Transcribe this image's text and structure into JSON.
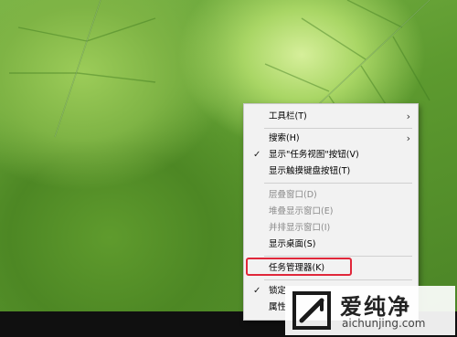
{
  "desktop": {
    "context_menu": {
      "items": [
        {
          "label": "工具栏(T)",
          "checked": false,
          "disabled": false,
          "submenu": true
        },
        {
          "label": "搜索(H)",
          "checked": false,
          "disabled": false,
          "submenu": true
        },
        {
          "label": "显示\"任务视图\"按钮(V)",
          "checked": true,
          "disabled": false,
          "submenu": false
        },
        {
          "label": "显示触摸键盘按钮(T)",
          "checked": false,
          "disabled": false,
          "submenu": false
        },
        {
          "label": "层叠窗口(D)",
          "checked": false,
          "disabled": true,
          "submenu": false
        },
        {
          "label": "堆叠显示窗口(E)",
          "checked": false,
          "disabled": true,
          "submenu": false
        },
        {
          "label": "并排显示窗口(I)",
          "checked": false,
          "disabled": true,
          "submenu": false
        },
        {
          "label": "显示桌面(S)",
          "checked": false,
          "disabled": false,
          "submenu": false
        },
        {
          "label": "任务管理器(K)",
          "checked": false,
          "disabled": false,
          "submenu": false,
          "highlighted": true
        },
        {
          "label": "锁定",
          "checked": true,
          "disabled": false,
          "submenu": false
        },
        {
          "label": "属性",
          "checked": false,
          "disabled": false,
          "submenu": false
        }
      ],
      "highlight_color": "#e0273a"
    }
  },
  "watermark": {
    "title": "爱纯净",
    "url": "aichunjing.com"
  },
  "icons": {
    "check": "✓",
    "submenu_arrow": "›"
  }
}
